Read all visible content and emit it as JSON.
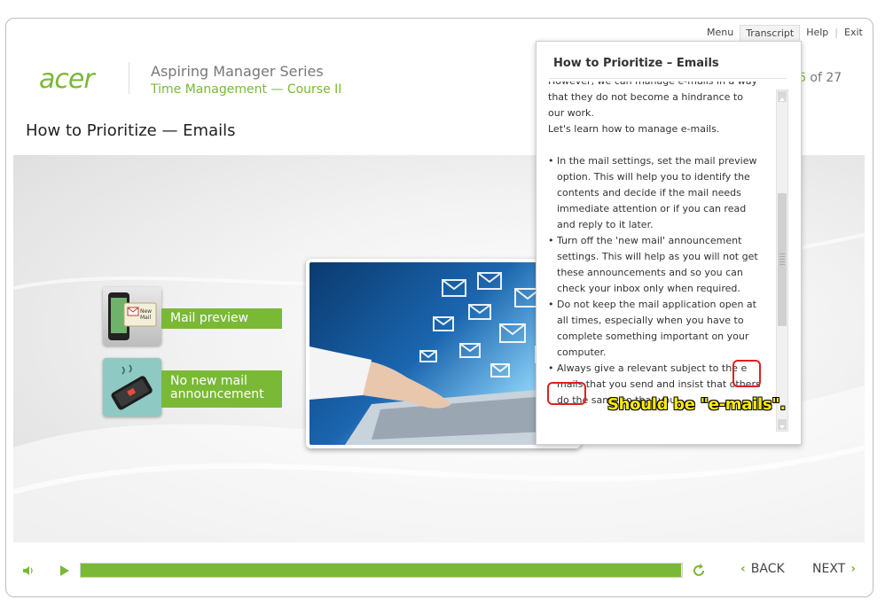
{
  "top_nav": {
    "menu": "Menu",
    "transcript": "Transcript",
    "help": "Help",
    "exit": "Exit",
    "separator": "|"
  },
  "header": {
    "logo": "acer",
    "series": "Aspiring Manager Series",
    "course": "Time Management — Course II",
    "page_current": "6",
    "page_suffix": " of 27"
  },
  "slide": {
    "title": "How to Prioritize — Emails",
    "items": [
      {
        "label": "Mail preview",
        "icon": "phone-mail-icon"
      },
      {
        "label_line1": "No new mail",
        "label_line2": "announcement",
        "icon": "phone-silent-icon"
      }
    ],
    "photo": "laptop-emails-image"
  },
  "transcript": {
    "title": "How to Prioritize – Emails",
    "lines": [
      "However, we can manage e-mails in a way",
      "that they do not become a hindrance to",
      "our work.",
      "Let's learn how to manage e-mails."
    ],
    "bullets": [
      [
        "• In the mail settings, set the mail preview",
        "option. This will help you to identify the",
        "contents and decide if the mail needs",
        "immediate attention or if you can read",
        "and reply to it later."
      ],
      [
        "• Turn off the 'new mail' announcement",
        "settings. This will help as you will not get",
        "these announcements and so you can",
        "check your inbox only when required."
      ],
      [
        "• Do not keep the mail application open at",
        "all times, especially when you have to",
        "complete something important on your",
        "computer."
      ],
      [
        "• Always give a relevant subject to the e",
        "mails that you send and insist that others",
        "do the same so that you"
      ]
    ]
  },
  "annotation": {
    "text": "Should be \"e-mails\".",
    "color": "#ffeb00",
    "mark_color": "#e02020"
  },
  "player": {
    "progress": 0.998,
    "back": "BACK",
    "next": "NEXT"
  },
  "colors": {
    "accent": "#7ab935"
  }
}
